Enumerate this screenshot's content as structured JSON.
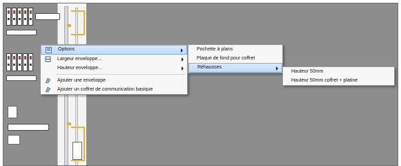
{
  "context_menu": {
    "items": [
      {
        "label": "Options",
        "icon": "options-icon",
        "submenu": true,
        "highlighted": true
      },
      {
        "label": "Largeur enveloppe...",
        "icon": "width-icon",
        "submenu": true
      },
      {
        "label": "Hauteur enveloppe...",
        "icon": "",
        "submenu": true
      },
      {
        "label": "Ajouter une enveloppe",
        "icon": "add-enclosure-icon",
        "submenu": false
      },
      {
        "label": "Ajouter un coffret de communication basique",
        "icon": "add-box-icon",
        "submenu": false
      }
    ]
  },
  "options_submenu": {
    "items": [
      {
        "label": "Pochette à plans"
      },
      {
        "label": "Plaque de fond pour coffret"
      },
      {
        "label": "Réhausses",
        "highlighted": true,
        "submenu": true
      }
    ]
  },
  "rehausses_submenu": {
    "items": [
      {
        "label": "Hauteur 50mm"
      },
      {
        "label": "Hauteur 50mm coffret + platine"
      }
    ]
  },
  "colors": {
    "canvas": "#8d8d8d",
    "highlight": "#c1dbfa",
    "accent_yellow": "#e0b630",
    "module_red": "#c0392b"
  }
}
